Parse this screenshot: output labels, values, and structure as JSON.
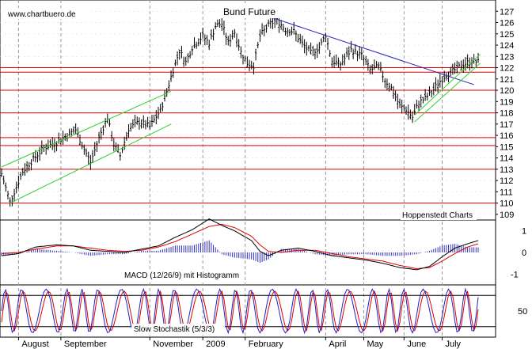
{
  "header": {
    "source_label": "www.chartbuero.de",
    "title": "Bund Future",
    "provider": "Hoppenstedt Charts",
    "macd_label": "MACD (12/26/9) mit Histogramm",
    "stoch_label": "Slow Stochastik (5/3/3)"
  },
  "colors": {
    "price": "#000000",
    "horizontal_lines": "#e00000",
    "trend_down": "#2020c0",
    "channel": "#30d030",
    "macd_line": "#000000",
    "signal_line": "#e00000",
    "histogram": "#3030c0",
    "stoch_k": "#2020c0",
    "stoch_d": "#e00000",
    "grid": "#999999"
  },
  "chart_data": [
    {
      "type": "line",
      "title": "Bund Future",
      "x_tick_labels": [
        "August",
        "September",
        "November",
        "2009",
        "February",
        "April",
        "May",
        "June",
        "July"
      ],
      "x_tick_positions": [
        8,
        28,
        70,
        95,
        115,
        153,
        171,
        190,
        208
      ],
      "ylim": [
        108.5,
        128
      ],
      "y_ticks": [
        109,
        110,
        111,
        112,
        113,
        114,
        115,
        116,
        117,
        118,
        119,
        120,
        121,
        122,
        123,
        124,
        125,
        126,
        127
      ],
      "grid": true,
      "n_bars": 226,
      "series": [
        {
          "role": "price",
          "anchors": [
            [
              0,
              112.6
            ],
            [
              4,
              110.1
            ],
            [
              6,
              111.0
            ],
            [
              10,
              112.8
            ],
            [
              15,
              113.9
            ],
            [
              20,
              114.9
            ],
            [
              26,
              115.4
            ],
            [
              30,
              115.9
            ],
            [
              35,
              116.5
            ],
            [
              38,
              115.2
            ],
            [
              42,
              113.6
            ],
            [
              46,
              115.8
            ],
            [
              50,
              117.6
            ],
            [
              53,
              115.2
            ],
            [
              56,
              114.2
            ],
            [
              60,
              116.6
            ],
            [
              65,
              117.2
            ],
            [
              70,
              116.8
            ],
            [
              75,
              118.2
            ],
            [
              78,
              119.9
            ],
            [
              81,
              121.8
            ],
            [
              84,
              123.5
            ],
            [
              87,
              122.5
            ],
            [
              90,
              123.8
            ],
            [
              95,
              124.8
            ],
            [
              98,
              124.2
            ],
            [
              101,
              125.7
            ],
            [
              104,
              125.9
            ],
            [
              107,
              124.2
            ],
            [
              110,
              125.2
            ],
            [
              113,
              123.4
            ],
            [
              116,
              122.4
            ],
            [
              119,
              122.2
            ],
            [
              122,
              124.8
            ],
            [
              126,
              125.8
            ],
            [
              130,
              126.2
            ],
            [
              134,
              125.4
            ],
            [
              138,
              125.2
            ],
            [
              142,
              124.1
            ],
            [
              146,
              123.3
            ],
            [
              150,
              123.8
            ],
            [
              153,
              124.9
            ],
            [
              156,
              122.6
            ],
            [
              160,
              122.3
            ],
            [
              165,
              123.6
            ],
            [
              170,
              123.1
            ],
            [
              174,
              121.8
            ],
            [
              178,
              122.1
            ],
            [
              181,
              120.9
            ],
            [
              184,
              120.2
            ],
            [
              188,
              118.6
            ],
            [
              191,
              118.3
            ],
            [
              194,
              117.6
            ],
            [
              197,
              118.9
            ],
            [
              200,
              119.3
            ],
            [
              203,
              119.8
            ],
            [
              206,
              120.6
            ],
            [
              210,
              121.4
            ],
            [
              214,
              121.8
            ],
            [
              218,
              122.3
            ],
            [
              222,
              122.6
            ],
            [
              225,
              122.5
            ]
          ]
        }
      ],
      "horizontal_levels": [
        121.6,
        122.0,
        120.0,
        118.0,
        115.8,
        115.1,
        113.0,
        110.0
      ],
      "trend_down": {
        "from": [
          125,
          126.6
        ],
        "to": [
          223,
          120.5
        ]
      },
      "channel_upper": {
        "from": [
          0,
          113.2
        ],
        "to": [
          80,
          119.9
        ]
      },
      "channel_lower": {
        "from": [
          4,
          110.0
        ],
        "to": [
          80,
          117.0
        ]
      },
      "channel_recent_upper": {
        "from": [
          195,
          117.8
        ],
        "to": [
          226,
          123.2
        ]
      },
      "channel_recent_lower": {
        "from": [
          195,
          117.2
        ],
        "to": [
          226,
          122.4
        ]
      }
    },
    {
      "type": "line",
      "title": "MACD (12/26/9) mit Histogramm",
      "ylim": [
        -1.5,
        1.5
      ],
      "y_ticks": [
        -1,
        0,
        1
      ],
      "series": [
        {
          "role": "macd",
          "anchors": [
            [
              0,
              -0.15
            ],
            [
              8,
              -0.05
            ],
            [
              16,
              0.25
            ],
            [
              26,
              0.35
            ],
            [
              34,
              0.3
            ],
            [
              42,
              0.1
            ],
            [
              50,
              0.05
            ],
            [
              58,
              0.0
            ],
            [
              66,
              0.15
            ],
            [
              74,
              0.3
            ],
            [
              82,
              0.7
            ],
            [
              90,
              1.05
            ],
            [
              98,
              1.55
            ],
            [
              104,
              1.25
            ],
            [
              110,
              1.0
            ],
            [
              118,
              0.55
            ],
            [
              122,
              0.05
            ],
            [
              126,
              -0.15
            ],
            [
              132,
              0.1
            ],
            [
              140,
              0.2
            ],
            [
              148,
              0.05
            ],
            [
              156,
              -0.15
            ],
            [
              164,
              -0.25
            ],
            [
              172,
              -0.35
            ],
            [
              180,
              -0.5
            ],
            [
              188,
              -0.7
            ],
            [
              196,
              -0.8
            ],
            [
              202,
              -0.65
            ],
            [
              208,
              -0.2
            ],
            [
              214,
              0.2
            ],
            [
              220,
              0.4
            ],
            [
              225,
              0.55
            ]
          ]
        },
        {
          "role": "signal",
          "anchors": [
            [
              0,
              -0.05
            ],
            [
              8,
              0.0
            ],
            [
              16,
              0.15
            ],
            [
              26,
              0.3
            ],
            [
              34,
              0.3
            ],
            [
              42,
              0.2
            ],
            [
              50,
              0.1
            ],
            [
              58,
              0.05
            ],
            [
              66,
              0.1
            ],
            [
              74,
              0.25
            ],
            [
              82,
              0.5
            ],
            [
              90,
              0.85
            ],
            [
              98,
              1.2
            ],
            [
              104,
              1.3
            ],
            [
              110,
              1.15
            ],
            [
              118,
              0.75
            ],
            [
              122,
              0.35
            ],
            [
              126,
              0.05
            ],
            [
              132,
              0.0
            ],
            [
              140,
              0.1
            ],
            [
              148,
              0.1
            ],
            [
              156,
              -0.05
            ],
            [
              164,
              -0.2
            ],
            [
              172,
              -0.3
            ],
            [
              180,
              -0.4
            ],
            [
              188,
              -0.6
            ],
            [
              196,
              -0.75
            ],
            [
              202,
              -0.7
            ],
            [
              208,
              -0.4
            ],
            [
              214,
              -0.05
            ],
            [
              220,
              0.25
            ],
            [
              225,
              0.4
            ]
          ]
        }
      ]
    },
    {
      "type": "line",
      "title": "Slow Stochastik (5/3/3)",
      "ylim": [
        0,
        100
      ],
      "y_ticks": [
        50
      ],
      "reference_levels": [
        80,
        20
      ],
      "series": [
        {
          "role": "stoch_k",
          "period": 9,
          "amplitude": 42,
          "center": 50
        },
        {
          "role": "stoch_d",
          "period": 9,
          "amplitude": 38,
          "center": 50
        }
      ]
    }
  ]
}
